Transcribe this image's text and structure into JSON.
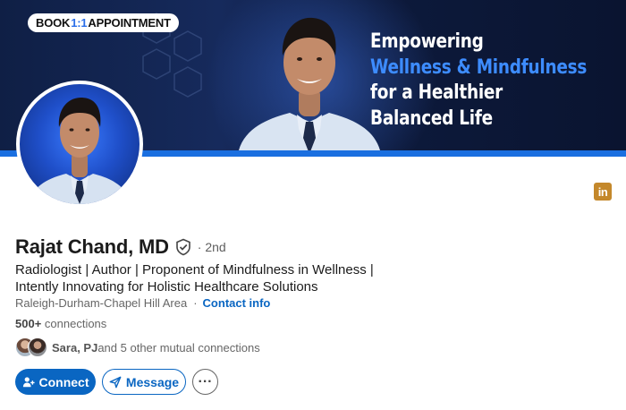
{
  "banner": {
    "badge": {
      "prefix": "BOOK ",
      "highlight": "1:1",
      "suffix": " APPOINTMENT"
    },
    "tagline": {
      "line1": "Empowering",
      "line2": "Wellness & Mindfulness",
      "line3": "for a Healthier",
      "line4": "Balanced Life"
    },
    "colors": {
      "background": "#13275a",
      "accent": "#3d8cff",
      "stripe": "#1a6fe0"
    }
  },
  "linkedin_badge": "in",
  "profile": {
    "name": "Rajat Chand, MD",
    "verified_icon": "shield-check-icon",
    "degree": "· 2nd",
    "headline_line1": "Radiologist | Author  | Proponent of Mindfulness in Wellness |",
    "headline_line2": "Intently Innovating for Holistic Healthcare Solutions",
    "location": "Raleigh-Durham-Chapel Hill Area",
    "location_separator": "·",
    "contact_info": "Contact info",
    "connections_count": "500+",
    "connections_label": " connections",
    "mutual_names": "Sara, PJ",
    "mutual_rest": " and 5 other mutual connections"
  },
  "actions": {
    "connect_label": "Connect",
    "message_label": "Message",
    "more_label": "···"
  }
}
